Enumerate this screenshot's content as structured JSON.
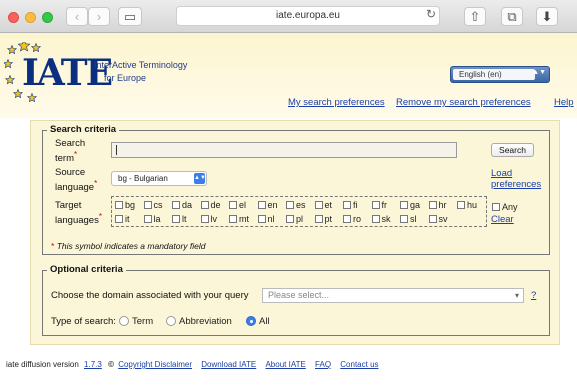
{
  "browser": {
    "url": "iate.europa.eu",
    "back_glyph": "‹",
    "forward_glyph": "›",
    "sidebar_glyph": "▭",
    "reload_glyph": "↻",
    "share_glyph": "⇧",
    "tabs_glyph": "⧉",
    "download_glyph": "⬇"
  },
  "header": {
    "logo_text": "IATE",
    "tagline_line1": "InterActive Terminology",
    "tagline_line2": "for Europe",
    "language": "English (en)",
    "links": {
      "search_prefs": "My search preferences",
      "remove_prefs": "Remove my search preferences",
      "help": "Help"
    },
    "star_color": "#f4c41a",
    "brand_color": "#0b2f80"
  },
  "search_criteria": {
    "legend": "Search criteria",
    "term_label_1": "Search",
    "term_label_2": "term",
    "term_value": "",
    "search_button": "Search",
    "source_label_1": "Source",
    "source_label_2": "language",
    "source_value": "bg - Bulgarian",
    "load_pref_1": "Load",
    "load_pref_2": "preferences",
    "target_label_1": "Target",
    "target_label_2": "languages",
    "languages_row1": [
      "bg",
      "cs",
      "da",
      "de",
      "el",
      "en",
      "es",
      "et",
      "fi",
      "fr",
      "ga",
      "hr",
      "hu"
    ],
    "languages_row2": [
      "it",
      "la",
      "lt",
      "lv",
      "mt",
      "nl",
      "pl",
      "pt",
      "ro",
      "sk",
      "sl",
      "sv"
    ],
    "any_label": "Any",
    "clear_label": "Clear",
    "mandatory_note": "This symbol indicates a mandatory field"
  },
  "optional_criteria": {
    "legend": "Optional criteria",
    "domain_label": "Choose the domain associated with your query",
    "domain_placeholder": "Please select...",
    "help_link": "?",
    "type_label": "Type of search:",
    "type_options": [
      "Term",
      "Abbreviation",
      "All"
    ],
    "type_selected": "All"
  },
  "footer": {
    "version_text": "iate diffusion version",
    "version": "1.7.3",
    "copyright_symbol": "©",
    "links": [
      "Copyright Disclaimer",
      "Download IATE",
      "About IATE",
      "FAQ",
      "Contact us"
    ]
  }
}
